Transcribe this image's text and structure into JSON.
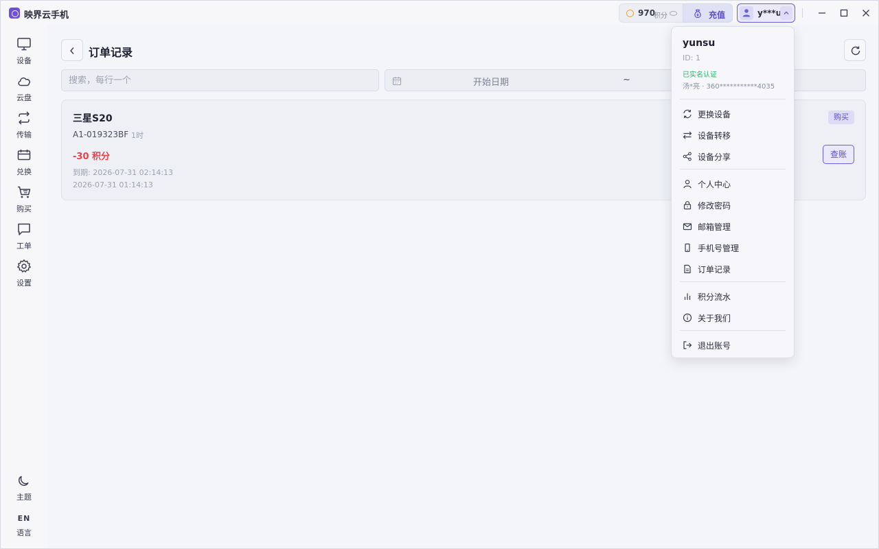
{
  "app": {
    "title": "映界云手机"
  },
  "header": {
    "points_value": "970",
    "points_unit": "积分",
    "recharge_label": "充值",
    "user_masked": "y***u"
  },
  "sidebar": {
    "items": [
      {
        "label": "设备",
        "icon": "monitor-icon"
      },
      {
        "label": "云盘",
        "icon": "cloud-icon"
      },
      {
        "label": "传输",
        "icon": "transfer-icon"
      },
      {
        "label": "兑换",
        "icon": "ticket-icon"
      },
      {
        "label": "购买",
        "icon": "cart-icon"
      },
      {
        "label": "工单",
        "icon": "message-icon"
      },
      {
        "label": "设置",
        "icon": "gear-icon"
      }
    ],
    "theme_label": "主题",
    "lang_code": "EN",
    "lang_label": "语言"
  },
  "main": {
    "page_title": "订单记录",
    "search_placeholder": "搜索，每行一个",
    "date_start_placeholder": "开始日期",
    "date_separator": "~",
    "orders": [
      {
        "name": "三星S20",
        "code": "A1-019323BF",
        "duration": "1时",
        "points": "-30 积分",
        "expire": "到期: 2026-07-31 02:14:13",
        "time": "2026-07-31 01:14:13",
        "tag": "购买",
        "action_label": "查账"
      }
    ]
  },
  "dropdown": {
    "username": "yunsu",
    "id_text": "ID: 1",
    "verified_text": "已实名认证",
    "real_info": "汤*亮 · 360***********4035",
    "groups": [
      [
        {
          "label": "更换设备",
          "icon": "swap-device-icon"
        },
        {
          "label": "设备转移",
          "icon": "arrows-transfer-icon"
        },
        {
          "label": "设备分享",
          "icon": "share-icon"
        }
      ],
      [
        {
          "label": "个人中心",
          "icon": "user-icon"
        },
        {
          "label": "修改密码",
          "icon": "lock-icon"
        },
        {
          "label": "邮箱管理",
          "icon": "mail-icon"
        },
        {
          "label": "手机号管理",
          "icon": "phone-icon"
        },
        {
          "label": "订单记录",
          "icon": "document-icon"
        }
      ],
      [
        {
          "label": "积分流水",
          "icon": "bar-chart-icon"
        },
        {
          "label": "关于我们",
          "icon": "info-icon"
        }
      ],
      [
        {
          "label": "退出账号",
          "icon": "logout-icon"
        }
      ]
    ]
  },
  "colors": {
    "accent": "#5a4fcf",
    "negative": "#e2434c",
    "verified": "#2bb46a",
    "coin": "#e4a93a"
  }
}
